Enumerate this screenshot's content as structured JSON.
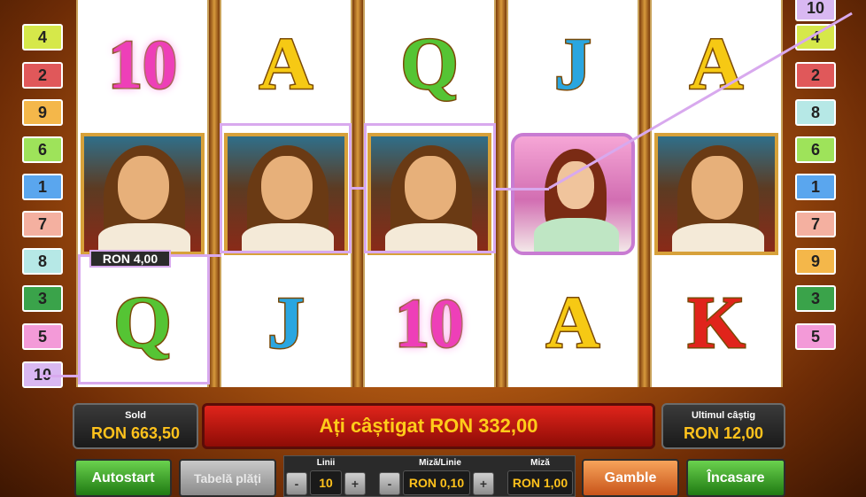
{
  "colors": {
    "win_line": "#d8a9ee",
    "amount": "#ffc21c",
    "message_bg": "#e0241b"
  },
  "left_lines": [
    {
      "label": "4",
      "color": "#d6e84a"
    },
    {
      "label": "2",
      "color": "#e0585a"
    },
    {
      "label": "9",
      "color": "#f4b74a"
    },
    {
      "label": "6",
      "color": "#9ee35a"
    },
    {
      "label": "1",
      "color": "#5aa6ee"
    },
    {
      "label": "7",
      "color": "#f4b0a0"
    },
    {
      "label": "8",
      "color": "#b6e8e6"
    },
    {
      "label": "3",
      "color": "#3aa34a"
    },
    {
      "label": "5",
      "color": "#f39ad8"
    },
    {
      "label": "10",
      "color": "#d9b8f2"
    }
  ],
  "right_lines": [
    {
      "label": "10",
      "color": "#d9b8f2"
    },
    {
      "label": "4",
      "color": "#d6e84a"
    },
    {
      "label": "2",
      "color": "#e0585a"
    },
    {
      "label": "8",
      "color": "#b6e8e6"
    },
    {
      "label": "6",
      "color": "#9ee35a"
    },
    {
      "label": "1",
      "color": "#5aa6ee"
    },
    {
      "label": "7",
      "color": "#f4b0a0"
    },
    {
      "label": "9",
      "color": "#f4b74a"
    },
    {
      "label": "3",
      "color": "#3aa34a"
    },
    {
      "label": "5",
      "color": "#f39ad8"
    }
  ],
  "reels": [
    [
      "10",
      "pirate",
      "Q"
    ],
    [
      "A",
      "pirate",
      "J"
    ],
    [
      "Q",
      "pirate",
      "10"
    ],
    [
      "J",
      "lady",
      "A"
    ],
    [
      "A",
      "pirate",
      "K"
    ]
  ],
  "win_tag": "RON 4,00",
  "sold": {
    "label": "Sold",
    "value": "RON 663,50"
  },
  "message": "Ați câștigat RON 332,00",
  "last_win": {
    "label": "Ultimul câștig",
    "value": "RON 12,00"
  },
  "buttons": {
    "autostart": "Autostart",
    "paytable": "Tabelă plăți",
    "gamble": "Gamble",
    "collect": "Încasare"
  },
  "lines": {
    "label": "Linii",
    "value": "10",
    "minus": "-",
    "plus": "+"
  },
  "bet_per_line": {
    "label": "Miză/Linie",
    "value": "RON 0,10",
    "minus": "-",
    "plus": "+"
  },
  "bet": {
    "label": "Miză",
    "value": "RON 1,00"
  }
}
